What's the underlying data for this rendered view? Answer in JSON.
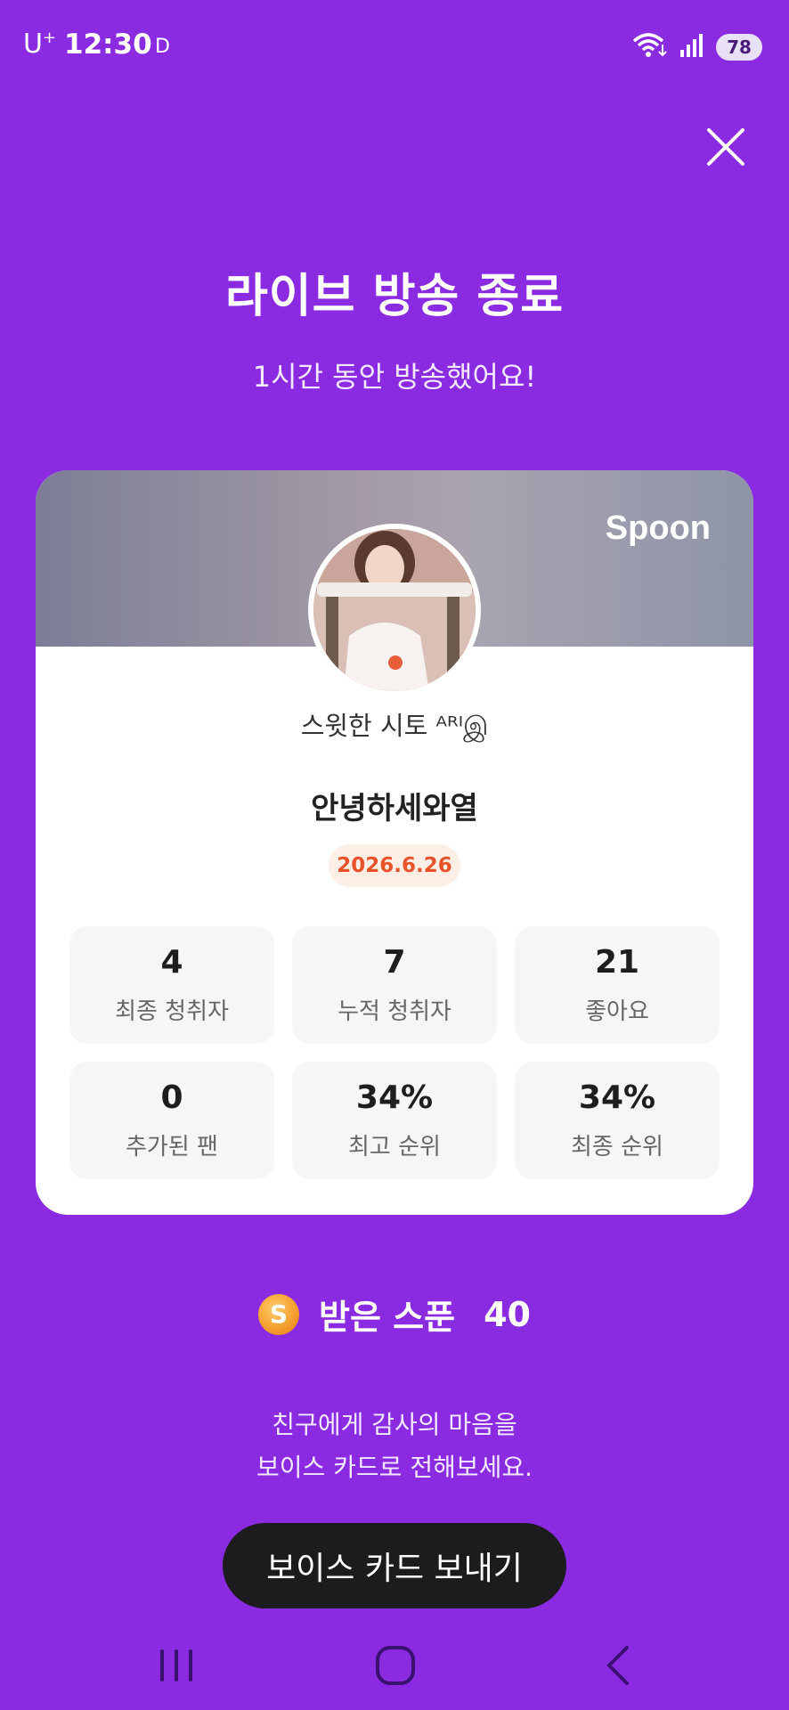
{
  "status_bar": {
    "carrier": "U",
    "carrier_plus": "+",
    "time": "12:30",
    "indicator": "D",
    "battery": "78"
  },
  "header": {
    "title": "라이브 방송 종료",
    "subtitle": "1시간 동안 방송했어요!"
  },
  "card": {
    "logo": "Spoon",
    "nickname": "스윗한 시토 ᴬᴿᴵஇ",
    "broadcast_title": "안녕하세와열",
    "date": "2026.6.26",
    "stats": [
      {
        "value": "4",
        "label": "최종 청취자"
      },
      {
        "value": "7",
        "label": "누적 청취자"
      },
      {
        "value": "21",
        "label": "좋아요"
      },
      {
        "value": "0",
        "label": "추가된 팬"
      },
      {
        "value": "34%",
        "label": "최고 순위"
      },
      {
        "value": "34%",
        "label": "최종 순위"
      }
    ]
  },
  "spoon": {
    "coin_letter": "S",
    "label": "받은 스푼",
    "count": "40"
  },
  "thanks": {
    "line1": "친구에게 감사의 마음을",
    "line2": "보이스 카드로 전해보세요."
  },
  "actions": {
    "voice_card_button": "보이스 카드 보내기"
  },
  "colors": {
    "background": "#8a2be2",
    "date_accent": "#e8532a",
    "button": "#1c1c1e"
  }
}
